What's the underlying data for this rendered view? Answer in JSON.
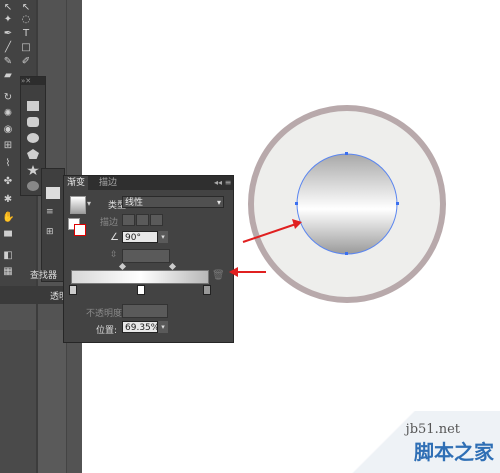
{
  "gradient_panel": {
    "tab_active": "渐变",
    "tab_inactive": "描边",
    "menu": "◂◂ ≡",
    "type_label": "类型:",
    "type_value": "线性",
    "stroke_label": "描边",
    "angle_value": "90°",
    "opacity_label": "不透明度",
    "position_label": "位置:",
    "position_value": "69.35%"
  },
  "side": {
    "layers_label": "查找器",
    "layers_label2": "透明"
  },
  "watermark": {
    "site": "jb51.net",
    "title": "脚本之家"
  },
  "colors": {
    "workspace": "#535353",
    "panel": "#434343",
    "ring": "#b8a9ab",
    "disc": "#eeeeec",
    "selection": "#3a6ff0",
    "arrow": "#e02020"
  }
}
